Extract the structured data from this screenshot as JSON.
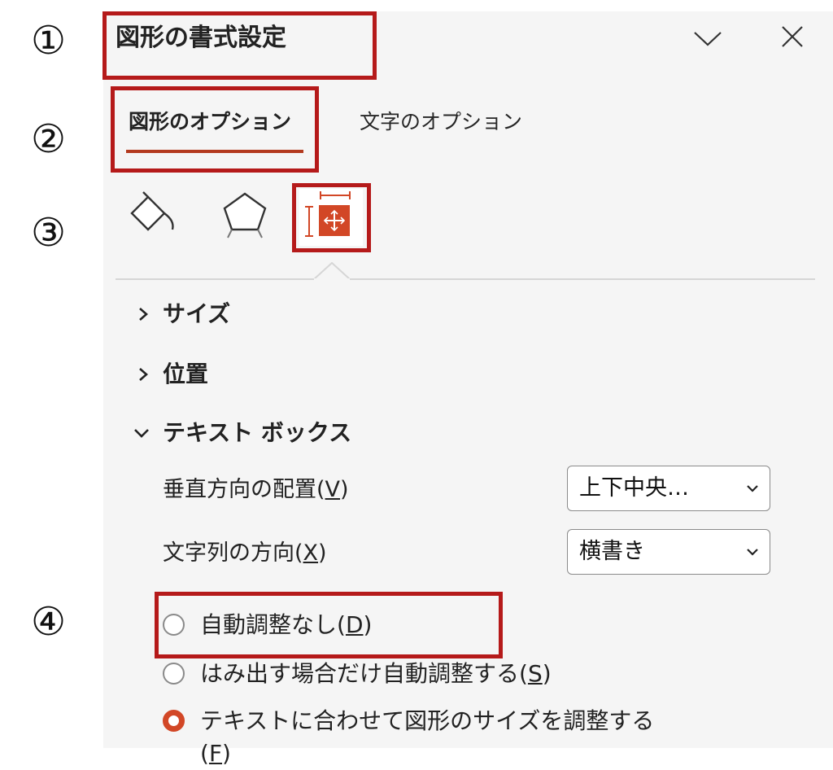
{
  "markers": [
    "①",
    "②",
    "③",
    "④"
  ],
  "pane": {
    "title": "図形の書式設定",
    "collapse_icon": "chevron-down-icon",
    "close_icon": "close-icon"
  },
  "tabs": [
    {
      "label": "図形のオプション",
      "active": true
    },
    {
      "label": "文字のオプション",
      "active": false
    }
  ],
  "icon_tabs": [
    {
      "icon": "fill-bucket-icon",
      "active": false
    },
    {
      "icon": "pentagon-effects-icon",
      "active": false
    },
    {
      "icon": "size-properties-icon",
      "active": true
    }
  ],
  "sections": [
    {
      "label": "サイズ",
      "expanded": false
    },
    {
      "label": "位置",
      "expanded": false
    },
    {
      "label": "テキスト ボックス",
      "expanded": true
    }
  ],
  "textbox": {
    "vertical_align": {
      "label_text": "垂直方向の配置(",
      "key": "V",
      "end": ")",
      "value": "上下中央…"
    },
    "text_direction": {
      "label_text": "文字列の方向(",
      "key": "X",
      "end": ")",
      "value": "横書き"
    },
    "options": [
      {
        "text": "自動調整なし(",
        "key": "D",
        "end": ")",
        "selected": false
      },
      {
        "text": "はみ出す場合だけ自動調整する(",
        "key": "S",
        "end": ")",
        "selected": false
      },
      {
        "text": "テキストに合わせて図形のサイズを調整する(",
        "key": "F",
        "end": ")",
        "selected": true
      }
    ]
  },
  "colors": {
    "highlight_red": "#b51a1a",
    "accent": "#d24726",
    "panel_bg": "#f5f5f5"
  }
}
